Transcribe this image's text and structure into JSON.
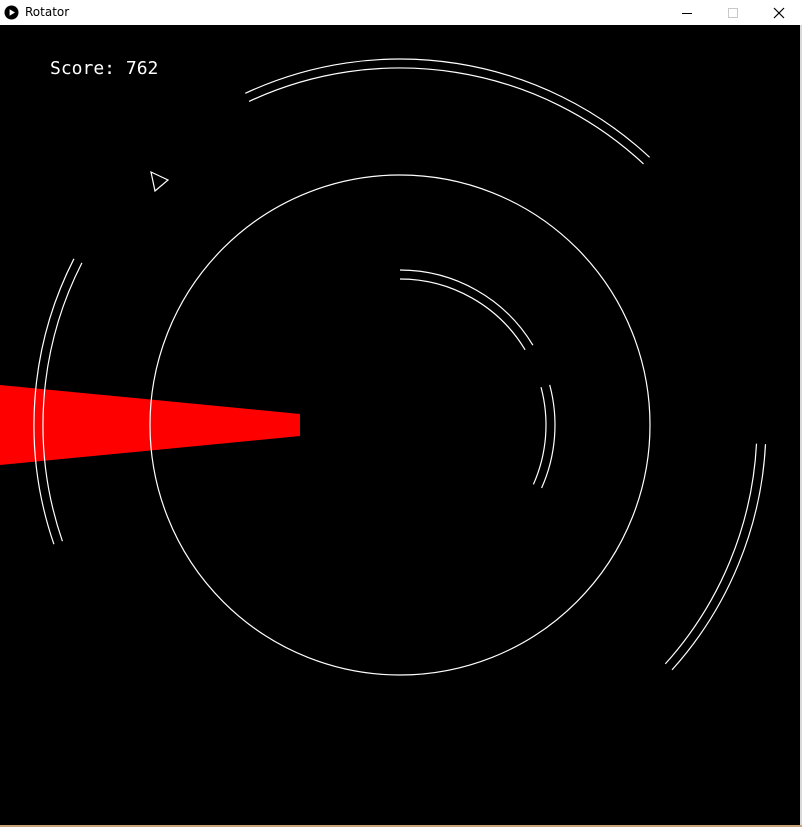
{
  "window": {
    "title": "Rotator",
    "icons": {
      "app": "play-circle-icon",
      "minimize": "minimize-icon",
      "maximize": "maximize-icon",
      "close": "close-icon"
    }
  },
  "hud": {
    "score_text": "Score: 762"
  },
  "colors": {
    "background": "#000000",
    "line": "#ffffff",
    "beam": "#ff0000"
  }
}
